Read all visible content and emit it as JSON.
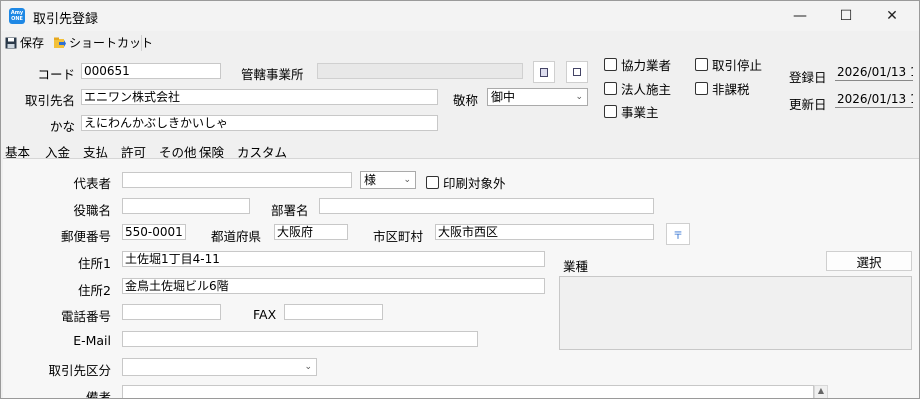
{
  "window": {
    "app_icon_text": "Amy ONE",
    "title": "取引先登録",
    "minimize_glyph": "—",
    "maximize_glyph": "☐",
    "close_glyph": "✕"
  },
  "toolbar": {
    "save_label": "保存",
    "shortcut_label": "ショートカット"
  },
  "header": {
    "code_label": "コード",
    "code_value": "000651",
    "jurisdiction_label": "管轄事業所",
    "jurisdiction_value": "",
    "name_label": "取引先名",
    "name_value": "エニワン株式会社",
    "honorific_label": "敬称",
    "honorific_value": "御中",
    "kana_label": "かな",
    "kana_value": "えにわんかぶしきかいしゃ",
    "checkboxes": [
      {
        "label": "協力業者",
        "checked": false
      },
      {
        "label": "取引停止",
        "checked": false
      },
      {
        "label": "法人施主",
        "checked": false
      },
      {
        "label": "非課税",
        "checked": false
      },
      {
        "label": "事業主",
        "checked": false
      }
    ],
    "registered_label": "登録日",
    "registered_value": "2026/01/13 1",
    "updated_label": "更新日",
    "updated_value": "2026/01/13 1"
  },
  "tabs": [
    "基本",
    "入金",
    "支払",
    "許可",
    "その他",
    "保険",
    "カスタム"
  ],
  "basic": {
    "rep_label": "代表者",
    "rep_value": "",
    "rep_suffix_value": "様",
    "print_target_label": "印刷対象外",
    "position_label": "役職名",
    "position_value": "",
    "dept_label": "部署名",
    "dept_value": "",
    "zip_label": "郵便番号",
    "zip_value": "550-0001",
    "pref_label": "都道府県",
    "pref_value": "大阪府",
    "city_label": "市区町村",
    "city_value": "大阪市西区",
    "zip_lookup_glyph": "〒",
    "addr1_label": "住所1",
    "addr1_value": "土佐堀1丁目4-11",
    "addr2_label": "住所2",
    "addr2_value": "金鳥土佐堀ビル6階",
    "tel_label": "電話番号",
    "tel_value": "",
    "fax_label": "FAX",
    "fax_value": "",
    "email_label": "E-Mail",
    "email_value": "",
    "category_label": "取引先区分",
    "category_value": "",
    "industry_label": "業種",
    "select_button": "選択",
    "notes_label": "備考",
    "notes_value": ""
  }
}
